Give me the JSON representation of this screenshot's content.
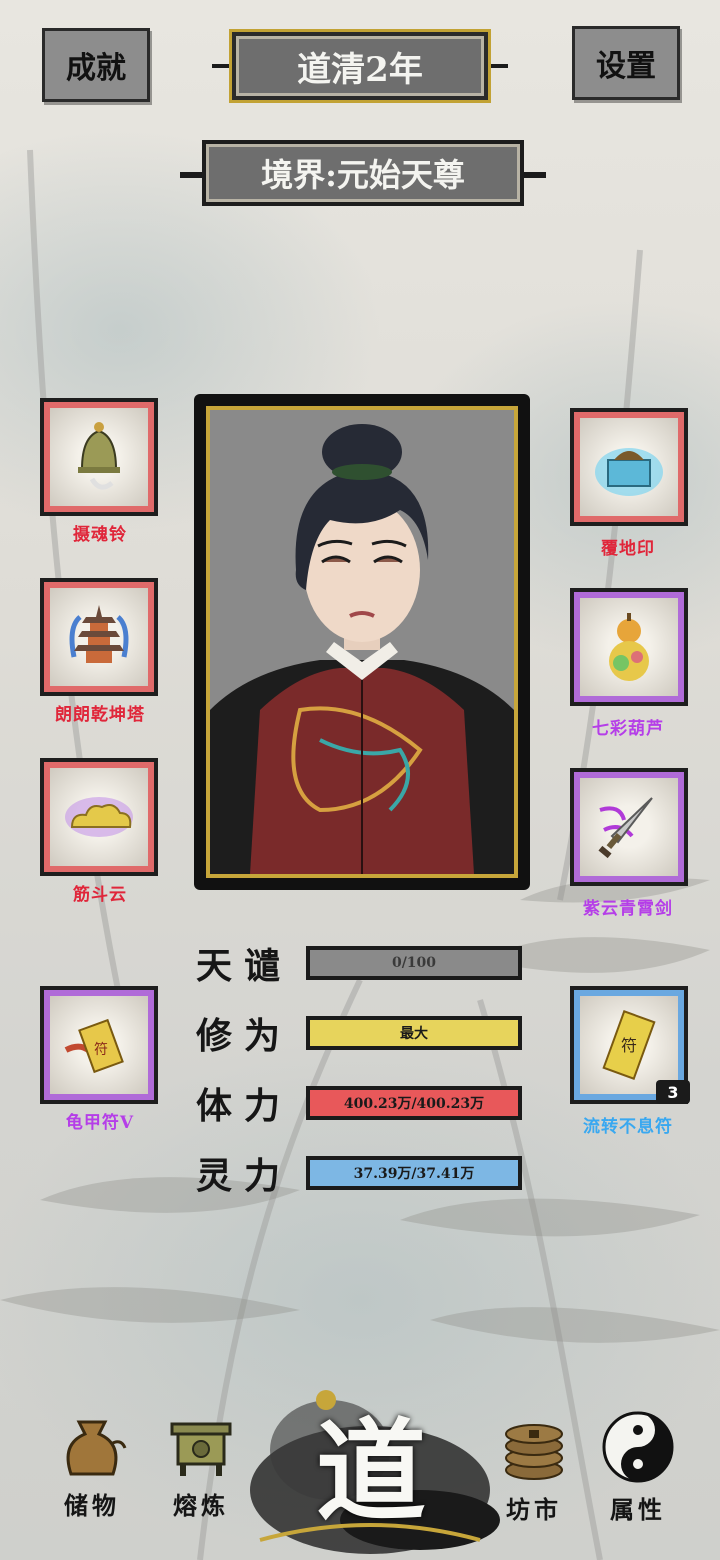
{
  "header": {
    "achievements_label": "成就",
    "year_title": "道清2年",
    "settings_label": "设置",
    "realm_title": "境界:元始天尊"
  },
  "left_items": [
    {
      "label": "摄魂铃",
      "rarity": "red",
      "icon": "bell-icon"
    },
    {
      "label": "朗朗乾坤塔",
      "rarity": "red",
      "icon": "pagoda-icon"
    },
    {
      "label": "筋斗云",
      "rarity": "red",
      "icon": "cloud-icon"
    },
    {
      "label": "龟甲符V",
      "rarity": "purple",
      "icon": "talisman-scroll-icon"
    }
  ],
  "right_items": [
    {
      "label": "覆地印",
      "rarity": "red",
      "icon": "seal-icon"
    },
    {
      "label": "七彩葫芦",
      "rarity": "purple",
      "icon": "gourd-icon"
    },
    {
      "label": "紫云青霄剑",
      "rarity": "purple",
      "icon": "sword-icon"
    },
    {
      "label": "流转不息符",
      "rarity": "blue",
      "icon": "talisman-icon",
      "count": "3"
    }
  ],
  "stats": [
    {
      "name": "天谴",
      "value": "0/100",
      "color": "#8a8a8a"
    },
    {
      "name": "修为",
      "value": "最大",
      "color": "#e7d45c"
    },
    {
      "name": "体力",
      "value": "400.23万/400.23万",
      "color": "#e8585a"
    },
    {
      "name": "灵力",
      "value": "37.39万/37.41万",
      "color": "#7db7e4"
    }
  ],
  "nav": {
    "storage": "储物",
    "smelting": "熔炼",
    "center": "道",
    "market": "坊市",
    "attributes": "属性"
  },
  "colors": {
    "rarity_red": "#e06a6a",
    "rarity_purple": "#b06bd8",
    "rarity_blue": "#6aa8e0"
  }
}
